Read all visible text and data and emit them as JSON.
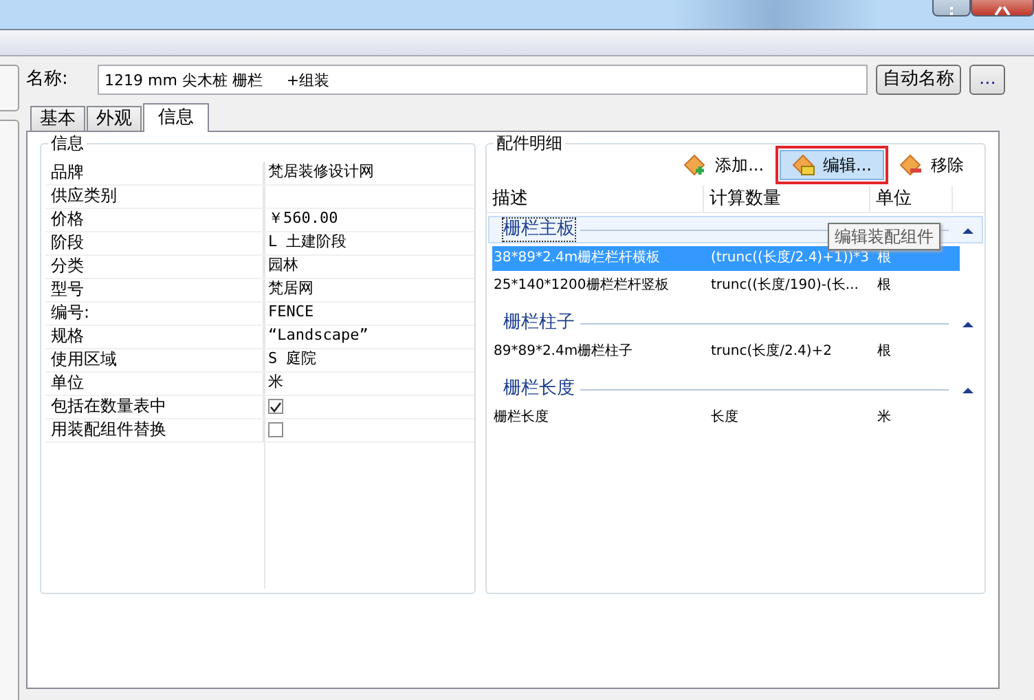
{
  "name_row": {
    "label": "名称:",
    "value": "1219 mm 尖木桩 栅栏     +组装",
    "buttons": [
      "自动名称",
      "..."
    ]
  },
  "tabs": [
    {
      "label": "基本",
      "selected": false
    },
    {
      "label": "外观",
      "selected": false
    },
    {
      "label": "信息",
      "selected": true
    }
  ],
  "info": {
    "title": "信息",
    "properties": [
      {
        "kind": "text",
        "name": "品牌",
        "value": "梵居装修设计网"
      },
      {
        "kind": "text",
        "name": "供应类别"
      },
      {
        "kind": "text",
        "name": "价格",
        "value": "￥560.00"
      },
      {
        "kind": "text",
        "name": "阶段",
        "value": "L  土建阶段"
      },
      {
        "kind": "text",
        "name": "分类",
        "value": "园林"
      },
      {
        "kind": "text",
        "name": "型号",
        "value": "梵居网"
      },
      {
        "kind": "text",
        "name": "编号:",
        "value": "FENCE"
      },
      {
        "kind": "text",
        "name": "规格",
        "value": "“Landscape”"
      },
      {
        "kind": "text",
        "name": "使用区域",
        "value": "S  庭院"
      },
      {
        "kind": "text",
        "name": "单位",
        "value": "米"
      },
      {
        "kind": "checkbox",
        "name": "包括在数量表中",
        "checked": true
      },
      {
        "kind": "checkbox",
        "name": "用装配组件替换",
        "checked": false
      }
    ]
  },
  "parts": {
    "title": "配件明细",
    "toolbar": [
      {
        "kind": "add",
        "label": "添加...",
        "selected": false
      },
      {
        "kind": "edit",
        "label": "编辑...",
        "selected": true
      },
      {
        "kind": "remove",
        "label": "移除",
        "selected": false
      }
    ],
    "tooltip": "编辑装配组件",
    "columns": [
      "描述",
      "计算数量",
      "单位"
    ],
    "groups": [
      {
        "title": "栅栏主板",
        "selected": true,
        "expanded": true,
        "rows": [
          {
            "cells": [
              "38*89*2.4m栅栏栏杆横板",
              "(trunc((长度/2.4)+1))*3",
              "根"
            ],
            "selected": true
          },
          {
            "cells": [
              "25*140*1200栅栏栏杆竖板",
              "trunc((长度/190)-(长...",
              "根"
            ],
            "selected": false
          }
        ]
      },
      {
        "title": "栅栏柱子",
        "selected": false,
        "expanded": true,
        "rows": [
          {
            "cells": [
              "89*89*2.4m栅栏柱子",
              "trunc(长度/2.4)+2",
              "根"
            ],
            "selected": false
          }
        ]
      },
      {
        "title": "栅栏长度",
        "selected": false,
        "expanded": true,
        "rows": [
          {
            "cells": [
              "栅栏长度",
              "长度",
              "米"
            ],
            "selected": false
          }
        ]
      }
    ]
  }
}
